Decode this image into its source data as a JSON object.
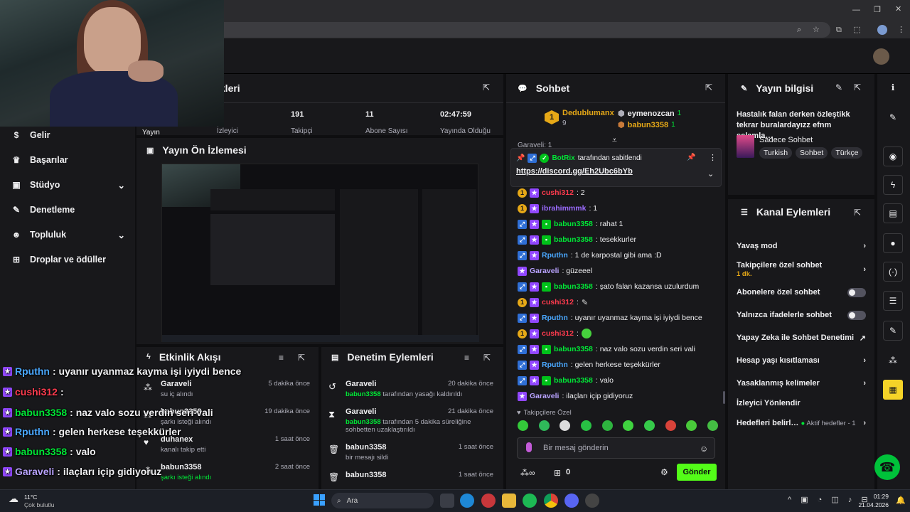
{
  "topbar": {
    "addr_icons": [
      "zoom-icon",
      "star-icon",
      "translate-icon",
      "extensions-icon",
      "profile-icon",
      "menu-icon"
    ]
  },
  "sidebar": {
    "items": [
      {
        "label": "Gelir",
        "icon": "dollar-icon"
      },
      {
        "label": "Başarılar",
        "icon": "trophy-icon"
      },
      {
        "label": "Stüdyo",
        "icon": "studio-icon"
      },
      {
        "label": "Denetleme",
        "icon": "wrench-icon"
      },
      {
        "label": "Topluluk",
        "icon": "users-icon"
      },
      {
        "label": "Droplar ve ödüller",
        "icon": "gift-icon"
      }
    ]
  },
  "stats": {
    "title": "ikleri",
    "cells": [
      {
        "value": "",
        "label": "Yayın"
      },
      {
        "value": "",
        "label": "İzleyici"
      },
      {
        "value": "191",
        "label": "Takipçi"
      },
      {
        "value": "11",
        "label": "Abone Sayısı"
      },
      {
        "value": "02:47:59",
        "label": "Yayında Olduğu"
      }
    ]
  },
  "preview": {
    "title": "Yayın Ön İzlemesi"
  },
  "activity": {
    "title": "Etkinlik Akışı",
    "items": [
      {
        "name": "Garaveli",
        "sub": "su iç alındı",
        "time": "5 dakika önce"
      },
      {
        "name": "babun3358",
        "sub": "şarkı isteği alındı",
        "time": "19 dakika önce"
      },
      {
        "name": "duhanex",
        "sub": "kanalı takip etti",
        "time": "1 saat önce"
      },
      {
        "name": "babun3358",
        "sub": "şarkı isteği alındı",
        "time": "2 saat önce"
      }
    ]
  },
  "mod": {
    "title": "Denetim Eylemleri",
    "items": [
      {
        "name": "Garaveli",
        "actor": "babun3358",
        "sub": "tarafından yasağı kaldırıldı",
        "time": "20 dakika önce"
      },
      {
        "name": "Garaveli",
        "actor": "babun3358",
        "sub": "tarafından 5 dakika süreliğine sohbetten uzaklaştırıldı",
        "time": "21 dakika önce"
      },
      {
        "name": "babun3358",
        "actor": "",
        "sub": "bir mesajı sildi",
        "time": "1 saat önce"
      },
      {
        "name": "babun3358",
        "actor": "",
        "sub": "",
        "time": "1 saat önce"
      }
    ]
  },
  "chat": {
    "title": "Sohbet",
    "leaders": [
      {
        "rank": "1",
        "name": "Dedublumanx",
        "count": "9"
      },
      {
        "name": "eymenozcan",
        "count": "1"
      },
      {
        "name": "babun3358",
        "count": "1"
      }
    ],
    "partial_top": "Garaveli: 1",
    "pinned": {
      "by": "BotRix",
      "by_suffix": "tarafından sabitlendi",
      "link": "https://discord.gg/Eh2Ubc6bYb"
    },
    "messages": [
      {
        "user": "cushi312",
        "color": "#ff3b4e",
        "text": ": 2",
        "badges": [
          "gold",
          "prime"
        ]
      },
      {
        "user": "ibrahimmmk",
        "color": "#9b6bff",
        "text": ": 1",
        "badges": [
          "gold",
          "prime"
        ]
      },
      {
        "user": "babun3358",
        "color": "#00e636",
        "text": ": rahat 1",
        "badges": [
          "blue",
          "prime",
          "green"
        ]
      },
      {
        "user": "babun3358",
        "color": "#00e636",
        "text": ": tesekkurler",
        "badges": [
          "blue",
          "prime",
          "green"
        ]
      },
      {
        "user": "Rputhn",
        "color": "#4aa8ff",
        "text": ": 1 de karpostal gibi ama :D",
        "badges": [
          "blue",
          "prime"
        ]
      },
      {
        "user": "Garaveli",
        "color": "#b9a3ff",
        "text": ": güzeeel",
        "badges": [
          "prime"
        ]
      },
      {
        "user": "babun3358",
        "color": "#00e636",
        "text": ": şato falan kazansa uzulurdum",
        "badges": [
          "blue",
          "prime",
          "green"
        ]
      },
      {
        "user": "cushi312",
        "color": "#ff3b4e",
        "text": ":",
        "badges": [
          "gold",
          "prime"
        ]
      },
      {
        "user": "Rputhn",
        "color": "#4aa8ff",
        "text": ": uyanır uyanmaz kayma işi iyiydi bence",
        "badges": [
          "blue",
          "prime"
        ]
      },
      {
        "user": "cushi312",
        "color": "#ff3b4e",
        "text": ":",
        "badges": [
          "gold",
          "prime"
        ]
      },
      {
        "user": "babun3358",
        "color": "#00e636",
        "text": ": naz valo sozu verdin seri vali",
        "badges": [
          "blue",
          "prime",
          "green"
        ]
      },
      {
        "user": "Rputhn",
        "color": "#4aa8ff",
        "text": ": gelen herkese teşekkürler",
        "badges": [
          "blue",
          "prime"
        ]
      },
      {
        "user": "babun3358",
        "color": "#00e636",
        "text": ": valo",
        "badges": [
          "blue",
          "prime",
          "green"
        ]
      },
      {
        "user": "Garaveli",
        "color": "#b9a3ff",
        "text": ": ilaçları içip gidiyoruz",
        "badges": [
          "prime"
        ]
      }
    ],
    "followers_only": "Takipçilere Özel",
    "placeholder": "Bir mesaj gönderin",
    "points": "0",
    "send": "Gönder"
  },
  "info": {
    "title": "Yayın bilgisi",
    "stream_title": "Hastalık falan derken özleştikk tekrar buralardayızz efnm selamla…",
    "category": "Sadece Sohbet",
    "tags": [
      "Turkish",
      "Sohbet",
      "Türkçe"
    ]
  },
  "channel_actions": {
    "title": "Kanal Eylemleri",
    "items": [
      {
        "label": "Yavaş mod",
        "kind": "chevron"
      },
      {
        "label": "Takipçilere özel sohbet",
        "sub": "1 dk.",
        "kind": "chevron"
      },
      {
        "label": "Abonelere özel sohbet",
        "kind": "toggle"
      },
      {
        "label": "Yalnızca ifadelerle sohbet",
        "kind": "toggle"
      },
      {
        "label": "Yapay Zeka ile Sohbet Denetimi",
        "kind": "external"
      },
      {
        "label": "Hesap yaşı kısıtlaması",
        "kind": "chevron"
      },
      {
        "label": "Yasaklanmış kelimeler",
        "kind": "chevron"
      },
      {
        "label": "İzleyici Yönlendir",
        "kind": "none"
      },
      {
        "label": "Hedefleri belirl…",
        "sub": "Aktif hedefler - 1",
        "kind": "chevron"
      }
    ]
  },
  "overlay": {
    "lines": [
      {
        "user": "Rputhn",
        "color": "#4aa8ff",
        "text": ": uyanır uyanmaz kayma işi iyiydi bence"
      },
      {
        "user": "cushi312",
        "color": "#ff3b4e",
        "text": ":"
      },
      {
        "user": "babun3358",
        "color": "#00e636",
        "text": ": naz valo sozu verdin seri vali"
      },
      {
        "user": "Rputhn",
        "color": "#4aa8ff",
        "text": ": gelen herkese teşekkürler"
      },
      {
        "user": "babun3358",
        "color": "#00e636",
        "text": ": valo"
      },
      {
        "user": "Garaveli",
        "color": "#b9a3ff",
        "text": ": ilaçları içip gidiyoruz"
      }
    ]
  },
  "taskbar": {
    "weather_temp": "11°C",
    "weather_desc": "Çok bulutlu",
    "search": "Ara",
    "time": "01:29",
    "date": "21.04.2026"
  }
}
